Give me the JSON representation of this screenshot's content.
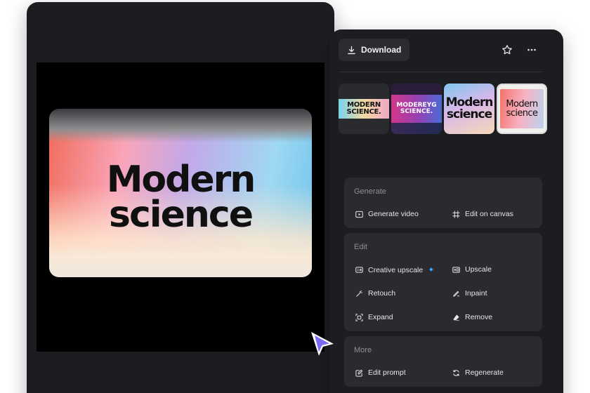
{
  "preview": {
    "line1": "Modern",
    "line2": "science"
  },
  "toolbar": {
    "download_label": "Download",
    "star_icon": "star-icon",
    "more_icon": "more-horizontal-icon"
  },
  "thumbnails": [
    {
      "line1": "MODERN",
      "line2": "SCIENCE."
    },
    {
      "line1": "MODEREYG",
      "line2": "SCIENCE."
    },
    {
      "line1": "Modern",
      "line2": "science"
    },
    {
      "line1": "Modern",
      "line2": "science"
    }
  ],
  "generate": {
    "title": "Generate",
    "actions": [
      {
        "label": "Generate video",
        "icon": "play-icon"
      },
      {
        "label": "Edit on canvas",
        "icon": "frame-icon"
      }
    ]
  },
  "edit": {
    "title": "Edit",
    "actions": [
      {
        "label": "Creative upscale",
        "icon": "upscale-icon"
      },
      {
        "label": "Upscale",
        "icon": "hd-icon"
      },
      {
        "label": "Retouch",
        "icon": "wand-icon"
      },
      {
        "label": "Inpaint",
        "icon": "inpaint-icon"
      },
      {
        "label": "Expand",
        "icon": "expand-icon"
      },
      {
        "label": "Remove",
        "icon": "eraser-icon"
      }
    ]
  },
  "more": {
    "title": "More",
    "actions": [
      {
        "label": "Edit prompt",
        "icon": "edit-prompt-icon"
      },
      {
        "label": "Regenerate",
        "icon": "regenerate-icon"
      }
    ]
  },
  "colors": {
    "panel_bg": "#1c1d20",
    "card_bg": "#2a2b2f",
    "pointer": "#7a6cf5",
    "sparkle": "#3ea7ff"
  }
}
